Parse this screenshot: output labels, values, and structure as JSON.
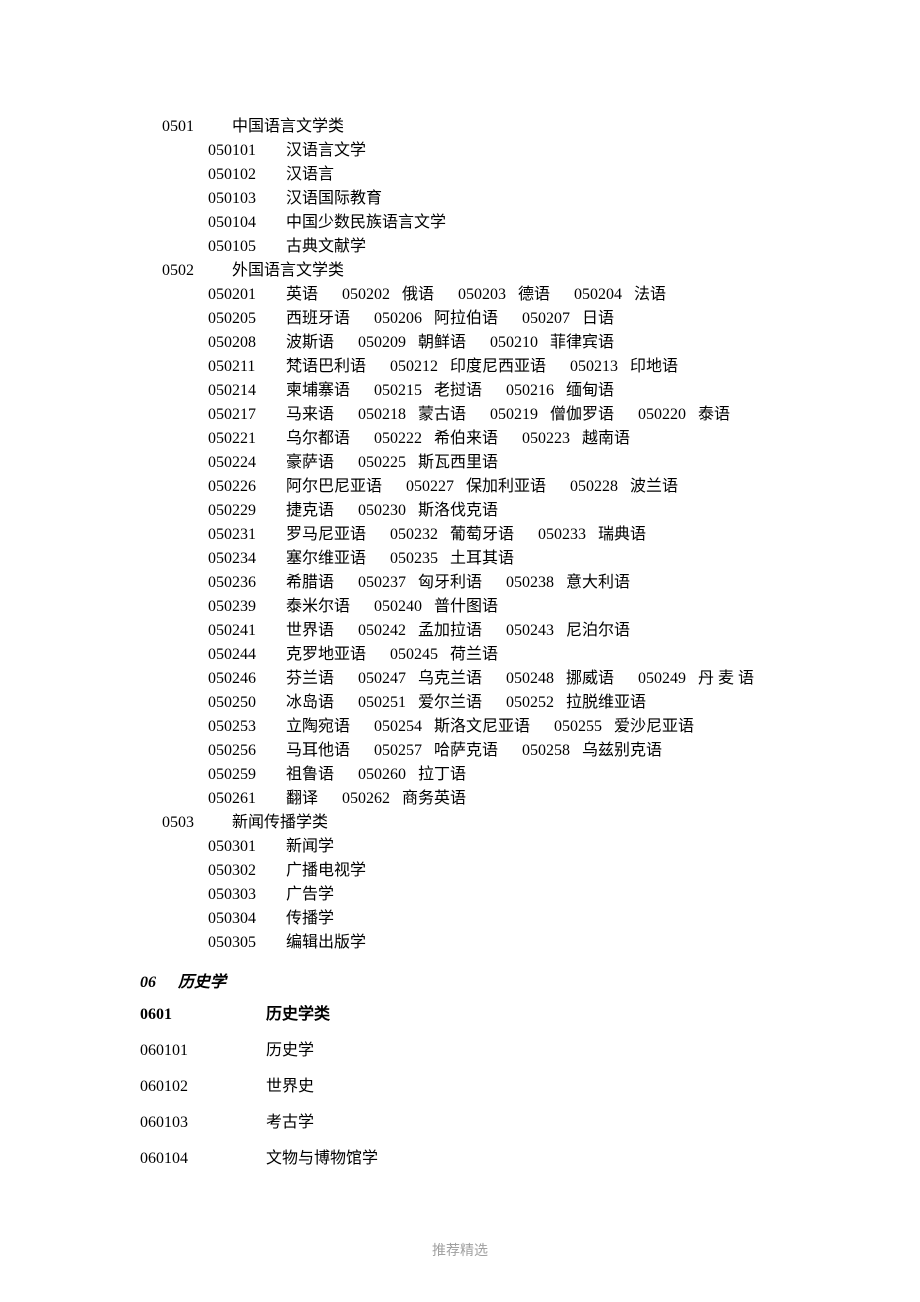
{
  "categories": [
    {
      "code": "0501",
      "name": "中国语言文学类",
      "subjects": [
        {
          "leadCode": "050101",
          "items": [
            {
              "code": "",
              "name": "汉语言文学"
            }
          ]
        },
        {
          "leadCode": "050102",
          "items": [
            {
              "code": "",
              "name": "汉语言"
            }
          ]
        },
        {
          "leadCode": "050103",
          "items": [
            {
              "code": "",
              "name": "汉语国际教育"
            }
          ]
        },
        {
          "leadCode": "050104",
          "items": [
            {
              "code": "",
              "name": "中国少数民族语言文学"
            }
          ]
        },
        {
          "leadCode": "050105",
          "items": [
            {
              "code": "",
              "name": "古典文献学"
            }
          ]
        }
      ]
    },
    {
      "code": "0502",
      "name": "外国语言文学类",
      "subjects": [
        {
          "leadCode": "050201",
          "items": [
            {
              "code": "",
              "name": "英语"
            },
            {
              "code": "050202",
              "name": "俄语"
            },
            {
              "code": "050203",
              "name": "德语"
            },
            {
              "code": "050204",
              "name": "法语"
            }
          ]
        },
        {
          "leadCode": "050205",
          "items": [
            {
              "code": "",
              "name": "西班牙语"
            },
            {
              "code": "050206",
              "name": "阿拉伯语"
            },
            {
              "code": "050207",
              "name": "日语"
            }
          ]
        },
        {
          "leadCode": "050208",
          "items": [
            {
              "code": "",
              "name": "波斯语"
            },
            {
              "code": "050209",
              "name": "朝鲜语"
            },
            {
              "code": "050210",
              "name": "菲律宾语"
            }
          ]
        },
        {
          "leadCode": "050211",
          "items": [
            {
              "code": "",
              "name": "梵语巴利语"
            },
            {
              "code": "050212",
              "name": "印度尼西亚语"
            },
            {
              "code": "050213",
              "name": "印地语"
            }
          ]
        },
        {
          "leadCode": "050214",
          "items": [
            {
              "code": "",
              "name": "柬埔寨语"
            },
            {
              "code": "050215",
              "name": "老挝语"
            },
            {
              "code": "050216",
              "name": "缅甸语"
            }
          ]
        },
        {
          "leadCode": "050217",
          "items": [
            {
              "code": "",
              "name": "马来语"
            },
            {
              "code": "050218",
              "name": "蒙古语"
            },
            {
              "code": "050219",
              "name": "僧伽罗语"
            },
            {
              "code": "050220",
              "name": "泰语"
            }
          ]
        },
        {
          "leadCode": "050221",
          "items": [
            {
              "code": "",
              "name": "乌尔都语"
            },
            {
              "code": "050222",
              "name": "希伯来语"
            },
            {
              "code": "050223",
              "name": "越南语"
            }
          ]
        },
        {
          "leadCode": "050224",
          "items": [
            {
              "code": "",
              "name": "豪萨语"
            },
            {
              "code": "050225",
              "name": "斯瓦西里语"
            }
          ]
        },
        {
          "leadCode": "050226",
          "items": [
            {
              "code": "",
              "name": "阿尔巴尼亚语"
            },
            {
              "code": "050227",
              "name": "保加利亚语"
            },
            {
              "code": "050228",
              "name": "波兰语"
            }
          ]
        },
        {
          "leadCode": "050229",
          "items": [
            {
              "code": "",
              "name": "捷克语"
            },
            {
              "code": "050230",
              "name": "斯洛伐克语"
            }
          ]
        },
        {
          "leadCode": "050231",
          "items": [
            {
              "code": "",
              "name": "罗马尼亚语"
            },
            {
              "code": "050232",
              "name": "葡萄牙语"
            },
            {
              "code": "050233",
              "name": "瑞典语"
            }
          ]
        },
        {
          "leadCode": "050234",
          "items": [
            {
              "code": "",
              "name": "塞尔维亚语"
            },
            {
              "code": "050235",
              "name": "土耳其语"
            }
          ]
        },
        {
          "leadCode": "050236",
          "items": [
            {
              "code": "",
              "name": "希腊语"
            },
            {
              "code": "050237",
              "name": "匈牙利语"
            },
            {
              "code": "050238",
              "name": "意大利语"
            }
          ]
        },
        {
          "leadCode": "050239",
          "items": [
            {
              "code": "",
              "name": "泰米尔语"
            },
            {
              "code": "050240",
              "name": "普什图语"
            }
          ]
        },
        {
          "leadCode": "050241",
          "items": [
            {
              "code": "",
              "name": "世界语"
            },
            {
              "code": "050242",
              "name": "孟加拉语"
            },
            {
              "code": "050243",
              "name": "尼泊尔语"
            }
          ]
        },
        {
          "leadCode": "050244",
          "items": [
            {
              "code": "",
              "name": "克罗地亚语"
            },
            {
              "code": "050245",
              "name": "荷兰语"
            }
          ]
        },
        {
          "leadCode": "050246",
          "items": [
            {
              "code": "",
              "name": "芬兰语"
            },
            {
              "code": "050247",
              "name": "乌克兰语"
            },
            {
              "code": "050248",
              "name": "挪威语"
            },
            {
              "code": "050249",
              "name": "丹 麦 语"
            }
          ]
        },
        {
          "leadCode": "050250",
          "items": [
            {
              "code": "",
              "name": "冰岛语"
            },
            {
              "code": "050251",
              "name": "爱尔兰语"
            },
            {
              "code": "050252",
              "name": "拉脱维亚语"
            }
          ]
        },
        {
          "leadCode": "050253",
          "items": [
            {
              "code": "",
              "name": "立陶宛语"
            },
            {
              "code": "050254",
              "name": "斯洛文尼亚语"
            },
            {
              "code": "050255",
              "name": "爱沙尼亚语"
            }
          ]
        },
        {
          "leadCode": "050256",
          "items": [
            {
              "code": "",
              "name": "马耳他语"
            },
            {
              "code": "050257",
              "name": "哈萨克语"
            },
            {
              "code": "050258",
              "name": "乌兹别克语"
            }
          ]
        },
        {
          "leadCode": "050259",
          "items": [
            {
              "code": "",
              "name": "祖鲁语"
            },
            {
              "code": "050260",
              "name": "拉丁语"
            }
          ]
        },
        {
          "leadCode": "050261",
          "items": [
            {
              "code": "",
              "name": "翻译"
            },
            {
              "code": "050262",
              "name": "商务英语"
            }
          ]
        }
      ]
    },
    {
      "code": "0503",
      "name": "新闻传播学类",
      "subjects": [
        {
          "leadCode": "050301",
          "items": [
            {
              "code": "",
              "name": "新闻学"
            }
          ]
        },
        {
          "leadCode": "050302",
          "items": [
            {
              "code": "",
              "name": "广播电视学"
            }
          ]
        },
        {
          "leadCode": "050303",
          "items": [
            {
              "code": "",
              "name": "广告学"
            }
          ]
        },
        {
          "leadCode": "050304",
          "items": [
            {
              "code": "",
              "name": "传播学"
            }
          ]
        },
        {
          "leadCode": "050305",
          "items": [
            {
              "code": "",
              "name": "编辑出版学"
            }
          ]
        }
      ]
    }
  ],
  "discipline": {
    "code": "06",
    "name": "历史学"
  },
  "historyCategory": {
    "code": "0601",
    "name": "历史学类"
  },
  "historySubjects": [
    {
      "code": "060101",
      "name": "历史学"
    },
    {
      "code": "060102",
      "name": "世界史"
    },
    {
      "code": "060103",
      "name": "考古学"
    },
    {
      "code": "060104",
      "name": "文物与博物馆学"
    }
  ],
  "footer": "推荐精选"
}
